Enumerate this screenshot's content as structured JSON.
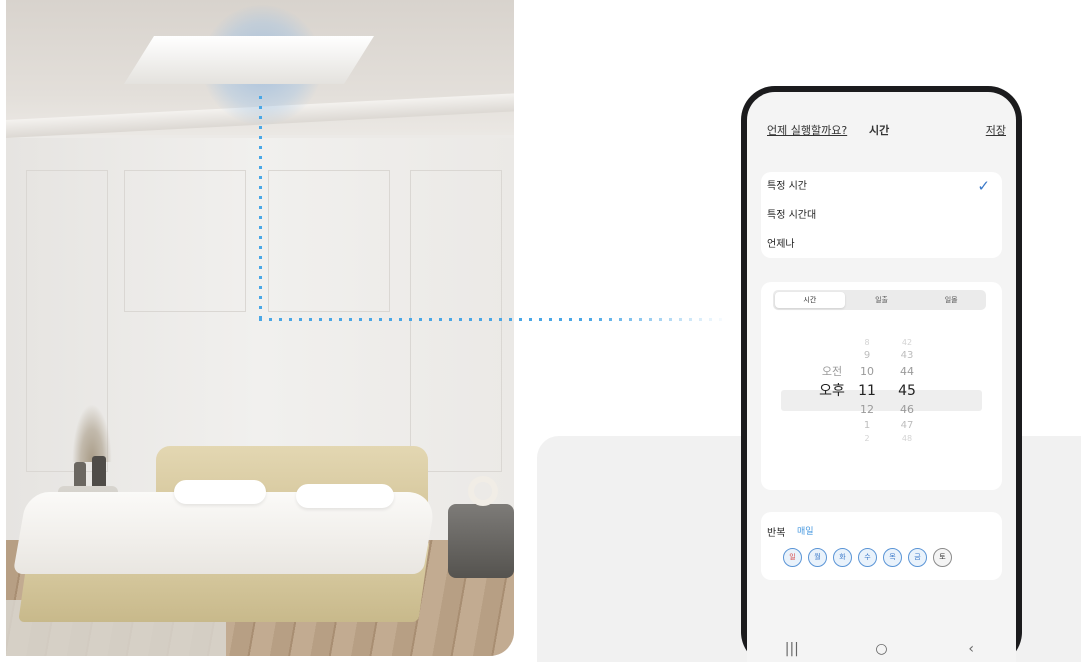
{
  "scene": {
    "accent_color": "#4aa7e6",
    "room_icons": [
      "ceiling-cassette-ac",
      "bed",
      "nightstand",
      "lamp"
    ]
  },
  "phone": {
    "header": {
      "left_label": "언제 실행할까요?",
      "title": "시간",
      "save_label": "저장"
    },
    "options": [
      {
        "label": "특정 시간",
        "selected": true
      },
      {
        "label": "특정 시간대",
        "selected": false
      },
      {
        "label": "언제나",
        "selected": false
      }
    ],
    "check_glyph": "✓",
    "segments": [
      "시간",
      "일출",
      "일몰"
    ],
    "active_segment": "시간",
    "picker": {
      "ampm": [
        "오전",
        "오후"
      ],
      "hours": [
        "8",
        "9",
        "10",
        "11",
        "12",
        "1",
        "2"
      ],
      "minutes": [
        "42",
        "43",
        "44",
        "45",
        "46",
        "47",
        "48"
      ],
      "selected": {
        "ampm": "오후",
        "hour": "11",
        "minute": "45"
      }
    },
    "repeat": {
      "label": "반복",
      "value": "매일",
      "days": [
        "일",
        "월",
        "화",
        "수",
        "목",
        "금",
        "토"
      ]
    },
    "navbar": {
      "recent_icon": "|||",
      "home_icon": "○",
      "back_icon": "‹"
    }
  }
}
